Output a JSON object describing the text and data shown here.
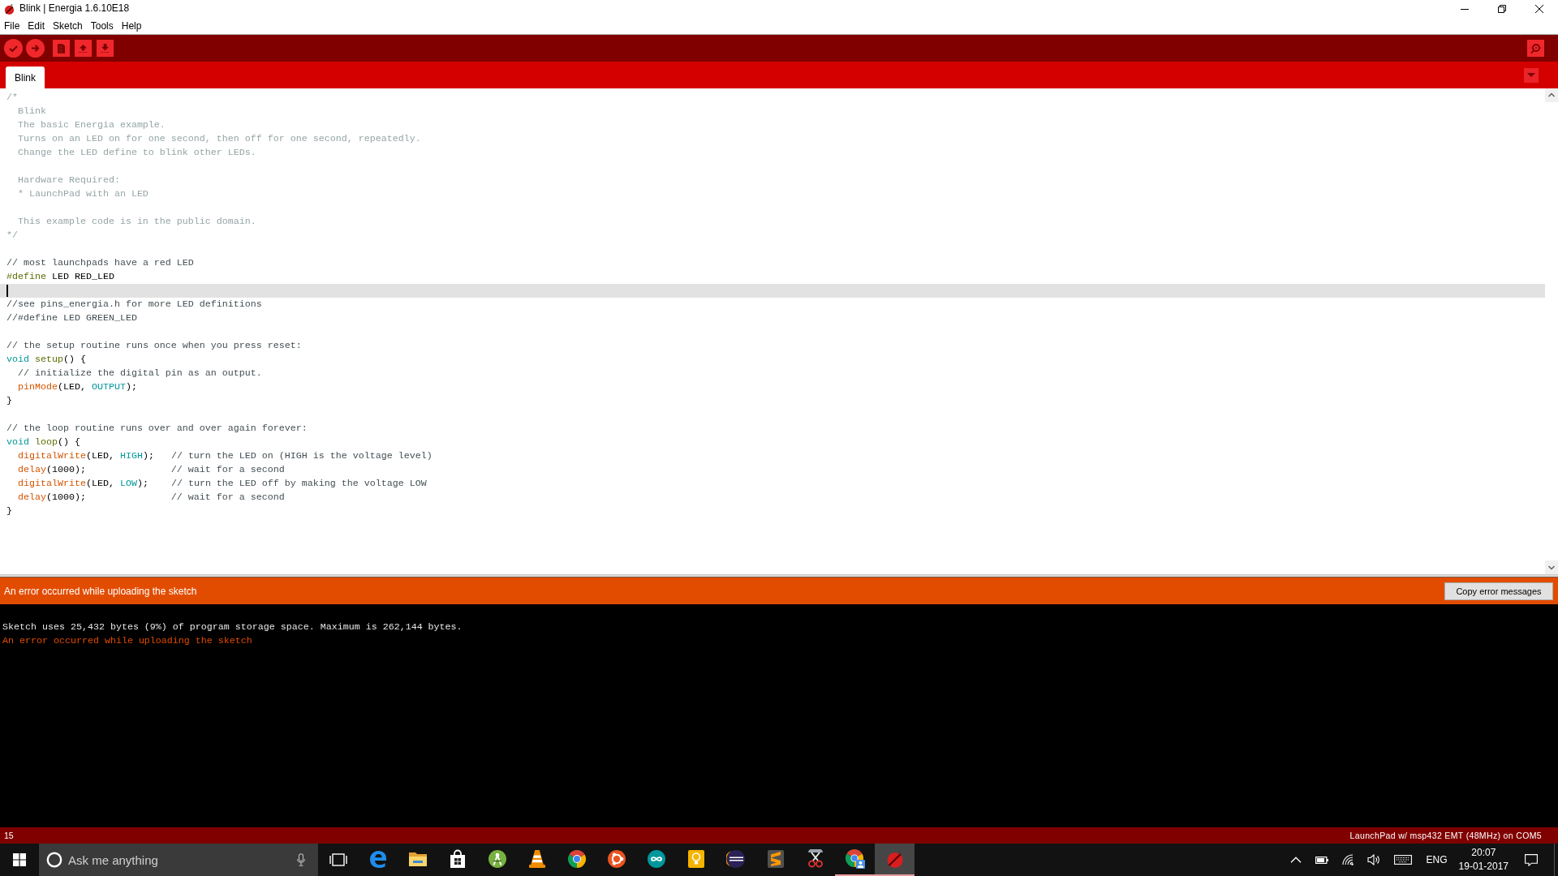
{
  "window": {
    "title": "Blink | Energia 1.6.10E18"
  },
  "menu": [
    "File",
    "Edit",
    "Sketch",
    "Tools",
    "Help"
  ],
  "tabs": [
    {
      "label": "Blink",
      "selected": true
    }
  ],
  "editor": {
    "lines": [
      {
        "current": false,
        "tokens": [
          {
            "kind": "comment",
            "text": "/*"
          }
        ]
      },
      {
        "current": false,
        "tokens": [
          {
            "kind": "comment",
            "text": "  Blink"
          }
        ]
      },
      {
        "current": false,
        "tokens": [
          {
            "kind": "comment",
            "text": "  The basic Energia example."
          }
        ]
      },
      {
        "current": false,
        "tokens": [
          {
            "kind": "comment",
            "text": "  Turns on an LED on for one second, then off for one second, repeatedly."
          }
        ]
      },
      {
        "current": false,
        "tokens": [
          {
            "kind": "comment",
            "text": "  Change the LED define to blink other LEDs."
          }
        ]
      },
      {
        "current": false
      },
      {
        "current": false,
        "tokens": [
          {
            "kind": "comment",
            "text": "  Hardware Required:"
          }
        ]
      },
      {
        "current": false,
        "tokens": [
          {
            "kind": "comment",
            "text": "  * LaunchPad with an LED"
          }
        ]
      },
      {
        "current": false
      },
      {
        "current": false,
        "tokens": [
          {
            "kind": "comment",
            "text": "  This example code is in the public domain."
          }
        ]
      },
      {
        "current": false,
        "tokens": [
          {
            "kind": "comment",
            "text": "*/"
          }
        ]
      },
      {
        "current": false
      },
      {
        "current": false,
        "tokens": [
          {
            "kind": "line_comment",
            "text": "// most launchpads have a red LED"
          }
        ]
      },
      {
        "current": false,
        "tokens": [
          {
            "kind": "preprocessor",
            "text": "#define"
          },
          {
            "kind": "plain",
            "text": " LED RED_LED"
          }
        ]
      },
      {
        "current": true
      },
      {
        "current": false,
        "tokens": [
          {
            "kind": "line_comment",
            "text": "//see pins_energia.h for more LED definitions"
          }
        ]
      },
      {
        "current": false,
        "tokens": [
          {
            "kind": "line_comment",
            "text": "//#define LED GREEN_LED"
          }
        ]
      },
      {
        "current": false
      },
      {
        "current": false,
        "tokens": [
          {
            "kind": "line_comment",
            "text": "// the setup routine runs once when you press reset:"
          }
        ]
      },
      {
        "current": false,
        "tokens": [
          {
            "kind": "keyword",
            "text": "void"
          },
          {
            "kind": "name",
            "text": " setup"
          },
          {
            "kind": "plain",
            "text": "() {"
          }
        ]
      },
      {
        "current": false,
        "tokens": [
          {
            "kind": "line_comment",
            "text": "  // initialize the digital pin as an output."
          }
        ]
      },
      {
        "current": false,
        "tokens": [
          {
            "kind": "function",
            "text": "  pinMode"
          },
          {
            "kind": "plain",
            "text": "(LED, "
          },
          {
            "kind": "constant",
            "text": "OUTPUT"
          },
          {
            "kind": "plain",
            "text": ");"
          }
        ]
      },
      {
        "current": false,
        "tokens": [
          {
            "kind": "plain",
            "text": "}"
          }
        ]
      },
      {
        "current": false
      },
      {
        "current": false,
        "tokens": [
          {
            "kind": "line_comment",
            "text": "// the loop routine runs over and over again forever:"
          }
        ]
      },
      {
        "current": false,
        "tokens": [
          {
            "kind": "keyword",
            "text": "void"
          },
          {
            "kind": "name",
            "text": " loop"
          },
          {
            "kind": "plain",
            "text": "() {"
          }
        ]
      },
      {
        "current": false,
        "tokens": [
          {
            "kind": "function",
            "text": "  digitalWrite"
          },
          {
            "kind": "plain",
            "text": "(LED, "
          },
          {
            "kind": "constant",
            "text": "HIGH"
          },
          {
            "kind": "plain",
            "text": ");   "
          },
          {
            "kind": "line_comment",
            "text": "// turn the LED on (HIGH is the voltage level)"
          }
        ]
      },
      {
        "current": false,
        "tokens": [
          {
            "kind": "function",
            "text": "  delay"
          },
          {
            "kind": "plain",
            "text": "(1000);               "
          },
          {
            "kind": "line_comment",
            "text": "// wait for a second"
          }
        ]
      },
      {
        "current": false,
        "tokens": [
          {
            "kind": "function",
            "text": "  digitalWrite"
          },
          {
            "kind": "plain",
            "text": "(LED, "
          },
          {
            "kind": "constant",
            "text": "LOW"
          },
          {
            "kind": "plain",
            "text": ");    "
          },
          {
            "kind": "line_comment",
            "text": "// turn the LED off by making the voltage LOW"
          }
        ]
      },
      {
        "current": false,
        "tokens": [
          {
            "kind": "function",
            "text": "  delay"
          },
          {
            "kind": "plain",
            "text": "(1000);               "
          },
          {
            "kind": "line_comment",
            "text": "// wait for a second"
          }
        ]
      },
      {
        "current": false,
        "tokens": [
          {
            "kind": "plain",
            "text": "}"
          }
        ]
      }
    ]
  },
  "messages": {
    "kind": "error",
    "status": "An error occurred while uploading the sketch",
    "button": "Copy error messages"
  },
  "console": {
    "lines": [
      {
        "kind": "info",
        "text": "Sketch uses 25,432 bytes (9%) of program storage space. Maximum is 262,144 bytes."
      },
      {
        "kind": "error",
        "text": "An error occurred while uploading the sketch"
      }
    ]
  },
  "status_bar": {
    "line": "15",
    "board": "LaunchPad w/ msp432 EMT (48MHz) on COM5"
  },
  "taskbar": {
    "search": {
      "placeholder": "Ask me anything"
    },
    "apps": [
      {
        "kind": "e_logo",
        "running": false,
        "selected": false
      },
      {
        "kind": "folder",
        "running": false,
        "selected": false
      },
      {
        "kind": "bag",
        "running": false,
        "selected": false
      },
      {
        "kind": "robot",
        "running": false,
        "selected": false
      },
      {
        "kind": "cone",
        "running": false,
        "selected": false
      },
      {
        "kind": "wheel",
        "running": false,
        "selected": false
      },
      {
        "kind": "friends",
        "running": false,
        "selected": false
      },
      {
        "kind": "infinity",
        "running": false,
        "selected": false
      },
      {
        "kind": "bulb",
        "running": false,
        "selected": false
      },
      {
        "kind": "sphere",
        "running": false,
        "selected": false
      },
      {
        "kind": "stripes",
        "running": false,
        "selected": false
      },
      {
        "kind": "scissors",
        "running": false,
        "selected": false
      },
      {
        "kind": "wheel_user",
        "running": true,
        "selected": false
      },
      {
        "kind": "bug",
        "running": true,
        "selected": true
      }
    ],
    "tray": {
      "language": "ENG",
      "time": "20:07",
      "date": "19-01-2017"
    }
  }
}
